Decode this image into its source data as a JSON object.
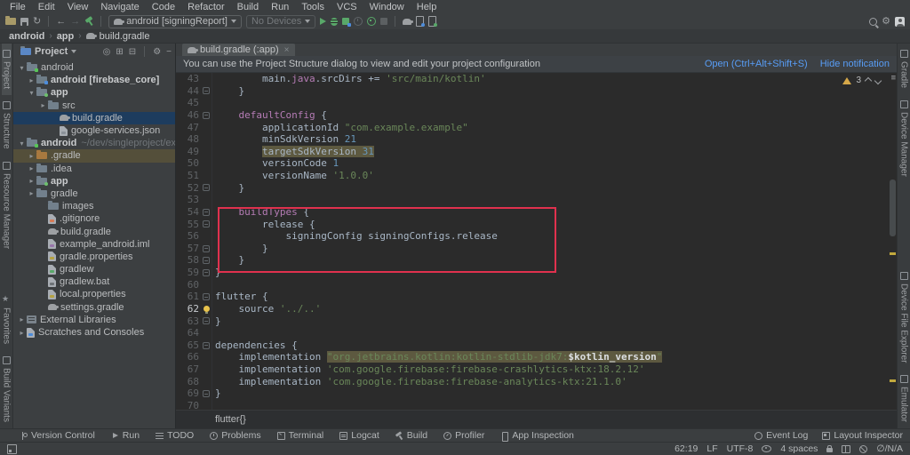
{
  "menubar": [
    "File",
    "Edit",
    "View",
    "Navigate",
    "Code",
    "Refactor",
    "Build",
    "Run",
    "Tools",
    "VCS",
    "Window",
    "Help"
  ],
  "toolbar": {
    "run_config": "android [signingReport]",
    "device": "No Devices"
  },
  "breadcrumb": [
    "android",
    "app",
    "build.gradle"
  ],
  "stripes": {
    "left_top": [
      [
        "Project",
        "folder"
      ],
      [
        "Structure",
        "grid"
      ],
      [
        "Resource Manager",
        "grid"
      ]
    ],
    "left_bottom": [
      [
        "Favorites",
        "star"
      ],
      [
        "Build Variants",
        "grid"
      ]
    ],
    "right_top": [
      [
        "Gradle",
        "grid"
      ],
      [
        "Device Manager",
        "grid"
      ]
    ],
    "right_bottom": [
      [
        "Device File Explorer",
        "grid"
      ],
      [
        "Emulator",
        "grid"
      ]
    ]
  },
  "project": {
    "title": "Project",
    "items": [
      {
        "pad": 4,
        "ch": "v",
        "icon": "folder-proj",
        "label": "android"
      },
      {
        "pad": 15,
        "ch": ">",
        "icon": "module",
        "label": "android [firebase_core]",
        "bold": true
      },
      {
        "pad": 15,
        "ch": "v",
        "icon": "folder-app",
        "label": "app",
        "bold": true
      },
      {
        "pad": 28,
        "ch": ">",
        "icon": "folder",
        "label": "src"
      },
      {
        "pad": 41,
        "ch": "",
        "icon": "gradle",
        "label": "build.gradle",
        "sel": true
      },
      {
        "pad": 41,
        "ch": "",
        "icon": "file-json",
        "label": "google-services.json"
      },
      {
        "pad": 4,
        "ch": "v",
        "icon": "folder-proj",
        "label": "android",
        "bold": true,
        "suffix": "~/dev/singleproject/exam"
      },
      {
        "pad": 15,
        "ch": ">",
        "icon": "folder-excl",
        "label": ".gradle",
        "hl": true
      },
      {
        "pad": 15,
        "ch": ">",
        "icon": "folder",
        "label": ".idea"
      },
      {
        "pad": 15,
        "ch": ">",
        "icon": "folder-app",
        "label": "app",
        "bold": true
      },
      {
        "pad": 15,
        "ch": ">",
        "icon": "folder",
        "label": "gradle"
      },
      {
        "pad": 28,
        "ch": "",
        "icon": "folder",
        "label": "images"
      },
      {
        "pad": 28,
        "ch": "",
        "icon": "file-git",
        "label": ".gitignore"
      },
      {
        "pad": 28,
        "ch": "",
        "icon": "gradle",
        "label": "build.gradle"
      },
      {
        "pad": 28,
        "ch": "",
        "icon": "file-iml",
        "label": "example_android.iml"
      },
      {
        "pad": 28,
        "ch": "",
        "icon": "file-props",
        "label": "gradle.properties"
      },
      {
        "pad": 28,
        "ch": "",
        "icon": "file-exec",
        "label": "gradlew"
      },
      {
        "pad": 28,
        "ch": "",
        "icon": "file-bat",
        "label": "gradlew.bat"
      },
      {
        "pad": 28,
        "ch": "",
        "icon": "file-props",
        "label": "local.properties"
      },
      {
        "pad": 28,
        "ch": "",
        "icon": "gradle",
        "label": "settings.gradle"
      },
      {
        "pad": 4,
        "ch": ">",
        "icon": "lib",
        "label": "External Libraries"
      },
      {
        "pad": 4,
        "ch": ">",
        "icon": "file-scratch",
        "label": "Scratches and Consoles"
      }
    ]
  },
  "editor": {
    "tab": "build.gradle (:app)",
    "notify": {
      "text": "You can use the Project Structure dialog to view and edit your project configuration",
      "open": "Open (Ctrl+Alt+Shift+S)",
      "hide": "Hide notification"
    },
    "warnings": "3",
    "bottom_crumb": "flutter{}",
    "lines": [
      {
        "n": 43,
        "t": [
          [
            "        main.",
            "p"
          ],
          [
            "java",
            "k"
          ],
          [
            ".srcDirs += ",
            "p"
          ],
          [
            "'src/main/kotlin'",
            "s"
          ]
        ]
      },
      {
        "n": 44,
        "f": 1,
        "t": [
          [
            "    }",
            "p"
          ]
        ]
      },
      {
        "n": 45,
        "t": []
      },
      {
        "n": 46,
        "f": 1,
        "t": [
          [
            "    ",
            "p"
          ],
          [
            "defaultConfig",
            "k"
          ],
          [
            " {",
            "p"
          ]
        ]
      },
      {
        "n": 47,
        "t": [
          [
            "        applicationId ",
            "p"
          ],
          [
            "\"com.example.example\"",
            "s"
          ]
        ]
      },
      {
        "n": 48,
        "t": [
          [
            "        minSdkVersion ",
            "p"
          ],
          [
            "21",
            "n"
          ]
        ]
      },
      {
        "n": 49,
        "t": [
          [
            "        ",
            "p"
          ],
          [
            "targetSdkVersion ",
            "ph"
          ],
          [
            "31",
            "nh"
          ]
        ]
      },
      {
        "n": 50,
        "t": [
          [
            "        versionCode ",
            "p"
          ],
          [
            "1",
            "n"
          ]
        ]
      },
      {
        "n": 51,
        "t": [
          [
            "        versionName ",
            "p"
          ],
          [
            "'1.0.0'",
            "s"
          ]
        ]
      },
      {
        "n": 52,
        "f": 1,
        "t": [
          [
            "    }",
            "p"
          ]
        ]
      },
      {
        "n": 53,
        "t": []
      },
      {
        "n": 54,
        "f": 1,
        "t": [
          [
            "    ",
            "p"
          ],
          [
            "buildTypes",
            "k"
          ],
          [
            " {",
            "p"
          ]
        ]
      },
      {
        "n": 55,
        "f": 1,
        "t": [
          [
            "        release {",
            "p"
          ]
        ]
      },
      {
        "n": 56,
        "t": [
          [
            "            signingConfig signingConfigs.release",
            "p"
          ]
        ]
      },
      {
        "n": 57,
        "f": 1,
        "t": [
          [
            "        }",
            "p"
          ]
        ]
      },
      {
        "n": 58,
        "f": 1,
        "t": [
          [
            "    }",
            "p"
          ]
        ]
      },
      {
        "n": 59,
        "f": 1,
        "t": [
          [
            "}",
            "p"
          ]
        ]
      },
      {
        "n": 60,
        "t": []
      },
      {
        "n": 61,
        "f": 1,
        "t": [
          [
            "flutter {",
            "p"
          ]
        ]
      },
      {
        "n": 62,
        "cur": 1,
        "bulb": 1,
        "t": [
          [
            "    source ",
            "p"
          ],
          [
            "'../..'",
            "s"
          ]
        ]
      },
      {
        "n": 63,
        "f": 1,
        "t": [
          [
            "}",
            "p"
          ]
        ]
      },
      {
        "n": 64,
        "t": []
      },
      {
        "n": 65,
        "f": 1,
        "t": [
          [
            "dependencies {",
            "p"
          ]
        ]
      },
      {
        "n": 66,
        "t": [
          [
            "    implementation ",
            "p"
          ],
          [
            "\"org.jetbrains.kotlin:kotlin-stdlib-jdk7:",
            "sh"
          ],
          [
            "$kotlin_version",
            "bh"
          ],
          [
            "\"",
            "sh"
          ]
        ]
      },
      {
        "n": 67,
        "t": [
          [
            "    implementation ",
            "p"
          ],
          [
            "'com.google.firebase:firebase-crashlytics-ktx:18.2.12'",
            "s"
          ]
        ]
      },
      {
        "n": 68,
        "t": [
          [
            "    implementation ",
            "p"
          ],
          [
            "'com.google.firebase:firebase-analytics-ktx:21.1.0'",
            "s"
          ]
        ]
      },
      {
        "n": 69,
        "f": 1,
        "t": [
          [
            "}",
            "p"
          ]
        ]
      },
      {
        "n": 70,
        "t": []
      }
    ]
  },
  "bottombar": {
    "left": [
      [
        "branch",
        "Version Control"
      ],
      [
        "play",
        "Run"
      ],
      [
        "list",
        "TODO"
      ],
      [
        "problem",
        "Problems"
      ],
      [
        "terminal",
        "Terminal"
      ],
      [
        "logcat",
        "Logcat"
      ],
      [
        "hammer",
        "Build"
      ],
      [
        "gauge",
        "Profiler"
      ],
      [
        "inspect",
        "App Inspection"
      ]
    ],
    "right": [
      [
        "bell",
        "Event Log"
      ],
      [
        "layout",
        "Layout Inspector"
      ]
    ]
  },
  "statusbar": {
    "pos": "62:19",
    "eol": "LF",
    "enc": "UTF-8",
    "indent": "4 spaces",
    "mem": "∅/N/A"
  }
}
